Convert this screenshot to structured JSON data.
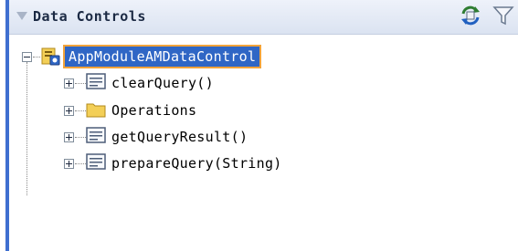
{
  "panel": {
    "title": "Data Controls",
    "icons": [
      "refresh-icon",
      "filter-icon"
    ]
  },
  "tree": {
    "root": {
      "label": "AppModuleAMDataControl",
      "icon": "data-control-icon",
      "expanded": true,
      "selected": true
    },
    "children": [
      {
        "label": "clearQuery()",
        "icon": "method-icon"
      },
      {
        "label": "Operations",
        "icon": "folder-icon"
      },
      {
        "label": "getQueryResult()",
        "icon": "method-icon"
      },
      {
        "label": "prepareQuery(String)",
        "icon": "method-icon"
      }
    ]
  },
  "colors": {
    "selection": "#2f66c5",
    "selection_border": "#f2a33a",
    "header_bg": "#dbe3f1",
    "folder": "#f3cf57"
  }
}
